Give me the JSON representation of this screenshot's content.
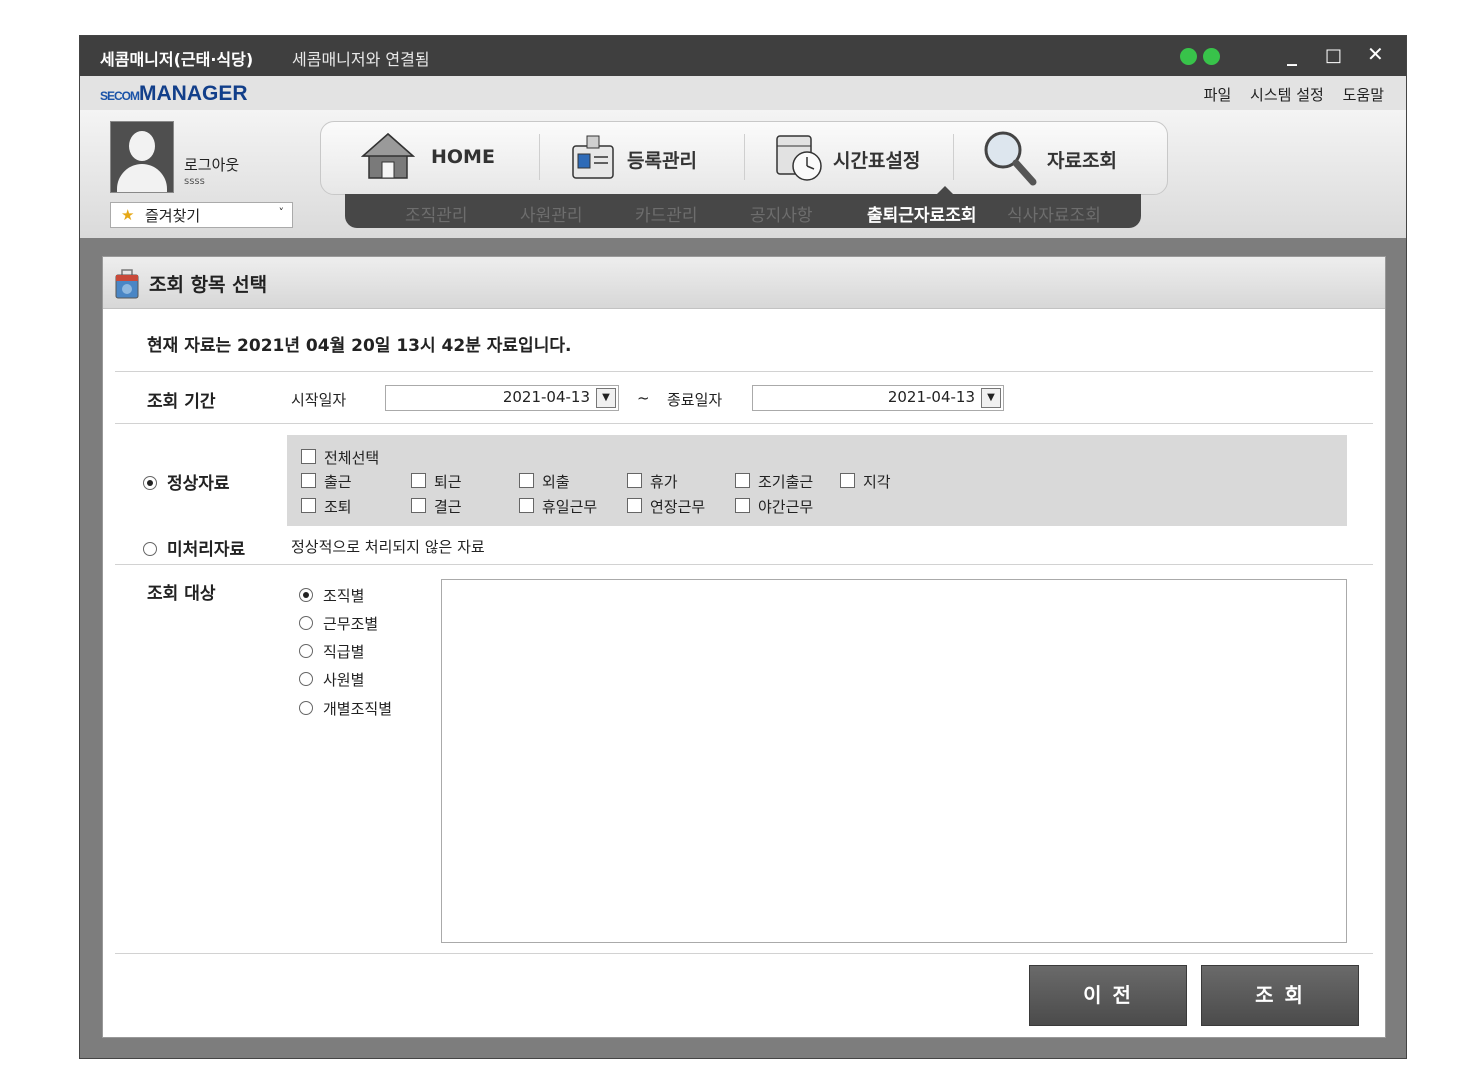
{
  "window": {
    "title": "세콤매니저(근태·식당)",
    "subtitle": "세콤매니저와 연결됨",
    "status_color": "#38c34a",
    "controls": {
      "minimize": "_",
      "maximize": "□",
      "close": "✕"
    }
  },
  "menubar": {
    "logo_secom": "SECOM",
    "logo_manager": "MANAGER",
    "items": [
      "파일",
      "시스템 설정",
      "도움말"
    ]
  },
  "user": {
    "logout_label": "로그아웃",
    "id": "ssss",
    "favorites_label": "즐겨찾기"
  },
  "nav": {
    "items": [
      {
        "label": "HOME",
        "icon": "home-icon"
      },
      {
        "label": "등록관리",
        "icon": "id-card-icon"
      },
      {
        "label": "시간표설정",
        "icon": "calendar-clock-icon"
      },
      {
        "label": "자료조회",
        "icon": "magnifier-icon"
      }
    ],
    "subitems": [
      "조직관리",
      "사원관리",
      "카드관리",
      "공지사항",
      "출퇴근자료조회",
      "식사자료조회"
    ],
    "active_subitem": "출퇴근자료조회"
  },
  "panel": {
    "title": "조회 항목 선택",
    "info": "현재 자료는 2021년 04월 20일 13시 42분 자료입니다.",
    "period": {
      "label": "조회 기간",
      "start_label": "시작일자",
      "start_value": "2021-04-13",
      "tilde": "~",
      "end_label": "종료일자",
      "end_value": "2021-04-13"
    },
    "normal": {
      "label": "정상자료",
      "selected": true,
      "checkboxes": [
        "전체선택",
        "출근",
        "퇴근",
        "외출",
        "휴가",
        "조기출근",
        "지각",
        "조퇴",
        "결근",
        "휴일근무",
        "연장근무",
        "야간근무"
      ]
    },
    "unprocessed": {
      "label": "미처리자료",
      "selected": false,
      "description": "정상적으로 처리되지 않은 자료"
    },
    "target": {
      "label": "조회 대상",
      "options": [
        "조직별",
        "근무조별",
        "직급별",
        "사원별",
        "개별조직별"
      ],
      "selected": "조직별"
    },
    "buttons": {
      "prev": "이 전",
      "search": "조 회"
    }
  }
}
